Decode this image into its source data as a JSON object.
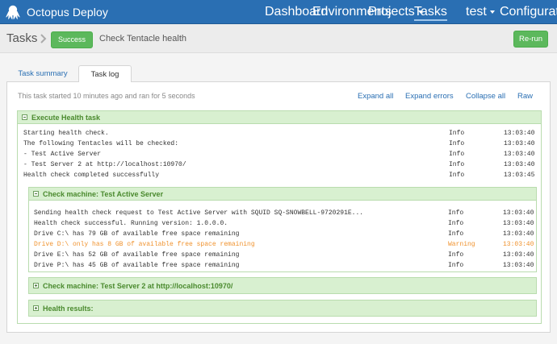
{
  "app": {
    "name": "Octopus Deploy"
  },
  "nav": {
    "items": [
      {
        "label": "Dashboard"
      },
      {
        "label": "Environments"
      },
      {
        "label": "Projects"
      },
      {
        "label": "Tasks"
      }
    ],
    "user": "test",
    "configuration": "Configuration"
  },
  "header": {
    "title": "Tasks",
    "status": "Success",
    "task_name": "Check Tentacle health",
    "rerun_label": "Re-run"
  },
  "tabs": [
    {
      "label": "Task summary"
    },
    {
      "label": "Task log"
    }
  ],
  "log": {
    "info": "This task started 10 minutes ago and ran for 5 seconds",
    "actions": {
      "expand_all": "Expand all",
      "expand_errors": "Expand errors",
      "collapse_all": "Collapse all",
      "raw": "Raw"
    },
    "root": {
      "title": "Execute Health task",
      "lines": [
        {
          "message": "Starting health check.",
          "level": "Info",
          "time": "13:03:40"
        },
        {
          "message": "The following Tentacles will be checked:",
          "level": "Info",
          "time": "13:03:40"
        },
        {
          "message": "- Test Active Server",
          "level": "Info",
          "time": "13:03:40"
        },
        {
          "message": "- Test Server 2 at http://localhost:10970/",
          "level": "Info",
          "time": "13:03:40"
        },
        {
          "message": "Health check completed successfully",
          "level": "Info",
          "time": "13:03:45"
        }
      ]
    },
    "machine1": {
      "title": "Check machine: Test Active Server",
      "lines": [
        {
          "message": "Sending health check request to Test Active Server with SQUID SQ-SNOWBELL-9720291E...",
          "level": "Info",
          "time": "13:03:40"
        },
        {
          "message": "Health check successful. Running version: 1.0.0.0.",
          "level": "Info",
          "time": "13:03:40"
        },
        {
          "message": "Drive C:\\ has 79 GB of available free space remaining",
          "level": "Info",
          "time": "13:03:40"
        },
        {
          "message": "Drive D:\\ only has 8 GB of available free space remaining",
          "level": "Warning",
          "time": "13:03:40"
        },
        {
          "message": "Drive E:\\ has 52 GB of available free space remaining",
          "level": "Info",
          "time": "13:03:40"
        },
        {
          "message": "Drive P:\\ has 45 GB of available free space remaining",
          "level": "Info",
          "time": "13:03:40"
        }
      ]
    },
    "machine2": {
      "title": "Check machine: Test Server 2 at http://localhost:10970/"
    },
    "results": {
      "title": "Health results:"
    }
  },
  "colors": {
    "nav_bg": "#2a6fb3",
    "success": "#5cb85c",
    "section_header": "#d8f0d0",
    "section_title": "#4a8a2e",
    "warning": "#f0922d",
    "link": "#2a6fb3"
  },
  "icons": {
    "logo": "octopus-logo-icon",
    "breadcrumb": "chevron-right-icon",
    "collapse": "collapse-toggle-icon",
    "expand": "expand-toggle-icon",
    "projects_menu": "caret-down-icon",
    "user_menu": "caret-down-icon"
  }
}
